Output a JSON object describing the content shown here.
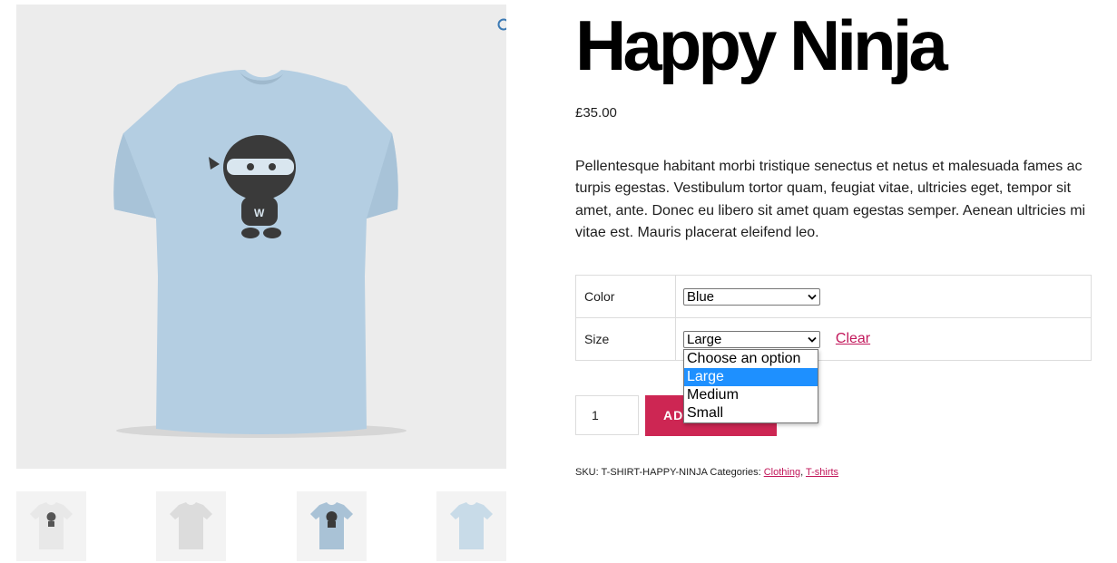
{
  "product": {
    "title": "Happy Ninja",
    "price": "£35.00",
    "description": "Pellentesque habitant morbi tristique senectus et netus et malesuada fames ac turpis egestas. Vestibulum tortor quam, feugiat vitae, ultricies eget, tempor sit amet, ante. Donec eu libero sit amet quam egestas semper. Aenean ultricies mi vitae est. Mauris placerat eleifend leo.",
    "image_icon": "blue-ninja-tshirt",
    "image_bg_color": "#ececec",
    "zoom_icon": "magnifier-icon"
  },
  "thumbnails": [
    {
      "icon": "white-ninja-tshirt-thumbnail",
      "color": "#e8e8e8"
    },
    {
      "icon": "gray-tshirt-thumbnail",
      "color": "#dcdcdc"
    },
    {
      "icon": "blue-ninja-tshirt-thumbnail",
      "color": "#a9c2d6"
    },
    {
      "icon": "light-blue-tshirt-thumbnail",
      "color": "#c8dbe8"
    }
  ],
  "variations": {
    "color": {
      "label": "Color",
      "selected": "Blue"
    },
    "size": {
      "label": "Size",
      "selected": "Large",
      "clear_label": "Clear"
    }
  },
  "size_dropdown": {
    "options": [
      "Choose an option",
      "Large",
      "Medium",
      "Small"
    ],
    "highlighted": "Large",
    "highlight_color": "#1e90ff"
  },
  "cart": {
    "quantity": "1",
    "add_button_label": "ADD TO CART",
    "button_color": "#cd2653"
  },
  "meta": {
    "sku_label": "SKU:",
    "sku_value": "T-SHIRT-HAPPY-NINJA",
    "categories_label": "Categories:",
    "categories": [
      "Clothing",
      "T-shirts"
    ],
    "separator": ", ",
    "link_color": "#c2185b"
  }
}
